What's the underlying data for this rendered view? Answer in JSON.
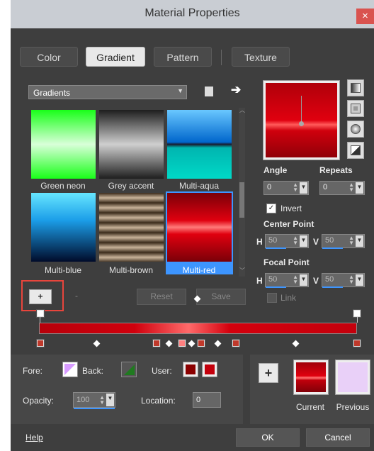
{
  "window": {
    "title": "Material Properties",
    "close_glyph": "×"
  },
  "tabs": [
    {
      "label": "Color"
    },
    {
      "label": "Gradient"
    },
    {
      "label": "Pattern"
    },
    {
      "label": "Texture"
    }
  ],
  "gradient_dropdown": {
    "value": "Gradients"
  },
  "gradients": [
    {
      "name": "Green neon"
    },
    {
      "name": "Grey accent"
    },
    {
      "name": "Multi-aqua"
    },
    {
      "name": "Multi-blue"
    },
    {
      "name": "Multi-brown"
    },
    {
      "name": "Multi-red"
    }
  ],
  "buttons": {
    "add": "+",
    "remove": "-",
    "reset": "Reset",
    "save": "Save",
    "ok": "OK",
    "cancel": "Cancel",
    "plus": "+"
  },
  "angle": {
    "label": "Angle",
    "value": "0"
  },
  "repeats": {
    "label": "Repeats",
    "value": "0"
  },
  "invert": {
    "label": "Invert",
    "checked": true
  },
  "center_point": {
    "label": "Center Point",
    "h_label": "H",
    "h": "50",
    "v_label": "V",
    "v": "50"
  },
  "focal_point": {
    "label": "Focal Point",
    "h_label": "H",
    "h": "50",
    "v_label": "V",
    "v": "50"
  },
  "link": {
    "label": "Link"
  },
  "fore": {
    "label": "Fore:"
  },
  "back": {
    "label": "Back:"
  },
  "user": {
    "label": "User:"
  },
  "opacity": {
    "label": "Opacity:",
    "value": "100"
  },
  "location": {
    "label": "Location:",
    "value": "0"
  },
  "current": {
    "label": "Current"
  },
  "previous": {
    "label": "Previous"
  },
  "help": {
    "label": "Help"
  },
  "colors": {
    "accent": "#3d95ff",
    "highlight_box": "#e8453c",
    "gradient_red": "#c4000c"
  }
}
